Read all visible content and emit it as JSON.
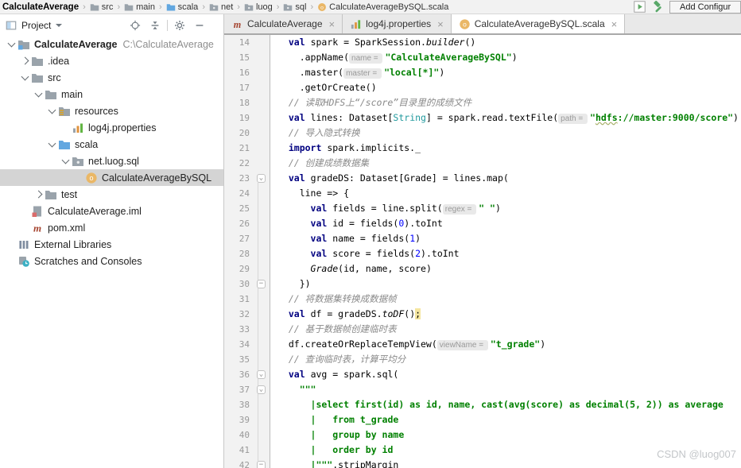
{
  "topbar": {
    "separator": "›",
    "breadcrumbs": [
      {
        "label": "CalculateAverage",
        "icon": null,
        "bold": true
      },
      {
        "label": "src",
        "icon": "folder"
      },
      {
        "label": "main",
        "icon": "folder"
      },
      {
        "label": "scala",
        "icon": "folder-blue"
      },
      {
        "label": "net",
        "icon": "package"
      },
      {
        "label": "luog",
        "icon": "package"
      },
      {
        "label": "sql",
        "icon": "package"
      },
      {
        "label": "CalculateAverageBySQL.scala",
        "icon": "scala-object"
      }
    ],
    "add_config_label": "Add Configur"
  },
  "project_panel": {
    "title": "Project",
    "header_icons": [
      "locate",
      "collapse-all",
      "|",
      "settings",
      "hide"
    ],
    "tree": [
      {
        "indent": 0,
        "arrow": "down",
        "icon": "project-root",
        "label": "CalculateAverage",
        "sub": "C:\\CalculateAverage",
        "bold": true
      },
      {
        "indent": 1,
        "arrow": "right",
        "icon": "folder",
        "label": ".idea"
      },
      {
        "indent": 1,
        "arrow": "down",
        "icon": "folder",
        "label": "src"
      },
      {
        "indent": 2,
        "arrow": "down",
        "icon": "folder",
        "label": "main"
      },
      {
        "indent": 3,
        "arrow": "down",
        "icon": "folder-res",
        "label": "resources"
      },
      {
        "indent": 4,
        "arrow": null,
        "icon": "props",
        "label": "log4j.properties"
      },
      {
        "indent": 3,
        "arrow": "down",
        "icon": "folder-blue",
        "label": "scala"
      },
      {
        "indent": 4,
        "arrow": "down",
        "icon": "package",
        "label": "net.luog.sql"
      },
      {
        "indent": 5,
        "arrow": null,
        "icon": "scala-object",
        "label": "CalculateAverageBySQL",
        "selected": true
      },
      {
        "indent": 2,
        "arrow": "right",
        "icon": "folder",
        "label": "test"
      },
      {
        "indent": 1,
        "arrow": null,
        "icon": "iml",
        "label": "CalculateAverage.iml"
      },
      {
        "indent": 1,
        "arrow": null,
        "icon": "maven",
        "label": "pom.xml"
      },
      {
        "indent": 0,
        "arrow": null,
        "icon": "libs",
        "label": "External Libraries"
      },
      {
        "indent": 0,
        "arrow": null,
        "icon": "scratches",
        "label": "Scratches and Consoles"
      }
    ]
  },
  "tabs": [
    {
      "label": "CalculateAverage",
      "icon": "maven",
      "active": false,
      "close": "×"
    },
    {
      "label": "log4j.properties",
      "icon": "props",
      "active": false,
      "close": "×"
    },
    {
      "label": "CalculateAverageBySQL.scala",
      "icon": "scala-object",
      "active": true,
      "close": "×"
    }
  ],
  "editor": {
    "lines": [
      {
        "n": 14,
        "fold": null,
        "tokens": [
          [
            "p",
            "  "
          ],
          [
            "k",
            "val"
          ],
          [
            "p",
            " spark = SparkSession."
          ],
          [
            "i",
            "builder"
          ],
          [
            "p",
            "()"
          ]
        ]
      },
      {
        "n": 15,
        "fold": null,
        "tokens": [
          [
            "p",
            "    .appName("
          ],
          [
            "h",
            "name = "
          ],
          [
            "s",
            "\"CalculateAverageBySQL\""
          ],
          [
            "p",
            ")"
          ]
        ]
      },
      {
        "n": 16,
        "fold": null,
        "tokens": [
          [
            "p",
            "    .master("
          ],
          [
            "h",
            "master = "
          ],
          [
            "s",
            "\"local[*]\""
          ],
          [
            "p",
            ")"
          ]
        ]
      },
      {
        "n": 17,
        "fold": null,
        "tokens": [
          [
            "p",
            "    .getOrCreate()"
          ]
        ]
      },
      {
        "n": 18,
        "fold": null,
        "tokens": [
          [
            "c",
            "  // 读取HDFS上“/score”目录里的成绩文件"
          ]
        ]
      },
      {
        "n": 19,
        "fold": null,
        "tokens": [
          [
            "p",
            "  "
          ],
          [
            "k",
            "val"
          ],
          [
            "p",
            " lines: Dataset["
          ],
          [
            "t",
            "String"
          ],
          [
            "p",
            "] = spark.read.textFile("
          ],
          [
            "h",
            "path = "
          ],
          [
            "s",
            "\""
          ],
          [
            "su",
            "hdfs"
          ],
          [
            "s",
            "://master:9000/score\""
          ],
          [
            "p",
            ")"
          ]
        ]
      },
      {
        "n": 20,
        "fold": null,
        "tokens": [
          [
            "c",
            "  // 导入隐式转换"
          ]
        ]
      },
      {
        "n": 21,
        "fold": null,
        "tokens": [
          [
            "p",
            "  "
          ],
          [
            "k",
            "import"
          ],
          [
            "p",
            " spark.implicits._"
          ]
        ]
      },
      {
        "n": 22,
        "fold": null,
        "tokens": [
          [
            "c",
            "  // 创建成绩数据集"
          ]
        ]
      },
      {
        "n": 23,
        "fold": "start",
        "tokens": [
          [
            "p",
            "  "
          ],
          [
            "k",
            "val"
          ],
          [
            "p",
            " gradeDS: Dataset[Grade] = lines.map("
          ]
        ]
      },
      {
        "n": 24,
        "fold": null,
        "tokens": [
          [
            "p",
            "    line => {"
          ]
        ]
      },
      {
        "n": 25,
        "fold": null,
        "tokens": [
          [
            "p",
            "      "
          ],
          [
            "k",
            "val"
          ],
          [
            "p",
            " fields = line.split("
          ],
          [
            "h",
            "regex = "
          ],
          [
            "s",
            "\" \""
          ],
          [
            "p",
            ")"
          ]
        ]
      },
      {
        "n": 26,
        "fold": null,
        "tokens": [
          [
            "p",
            "      "
          ],
          [
            "k",
            "val"
          ],
          [
            "p",
            " id = fields("
          ],
          [
            "n2",
            "0"
          ],
          [
            "p",
            ").toInt"
          ]
        ]
      },
      {
        "n": 27,
        "fold": null,
        "tokens": [
          [
            "p",
            "      "
          ],
          [
            "k",
            "val"
          ],
          [
            "p",
            " name = fields("
          ],
          [
            "n2",
            "1"
          ],
          [
            "p",
            ")"
          ]
        ]
      },
      {
        "n": 28,
        "fold": null,
        "tokens": [
          [
            "p",
            "      "
          ],
          [
            "k",
            "val"
          ],
          [
            "p",
            " score = fields("
          ],
          [
            "n2",
            "2"
          ],
          [
            "p",
            ").toInt"
          ]
        ]
      },
      {
        "n": 29,
        "fold": null,
        "tokens": [
          [
            "p",
            "      "
          ],
          [
            "i",
            "Grade"
          ],
          [
            "p",
            "(id, name, score)"
          ]
        ]
      },
      {
        "n": 30,
        "fold": "end",
        "tokens": [
          [
            "p",
            "    })"
          ]
        ]
      },
      {
        "n": 31,
        "fold": null,
        "tokens": [
          [
            "c",
            "  // 将数据集转换成数据帧"
          ]
        ]
      },
      {
        "n": 32,
        "fold": null,
        "tokens": [
          [
            "p",
            "  "
          ],
          [
            "k",
            "val"
          ],
          [
            "p",
            " df = gradeDS."
          ],
          [
            "i",
            "toDF"
          ],
          [
            "p",
            "()"
          ],
          [
            "w",
            ";"
          ]
        ]
      },
      {
        "n": 33,
        "fold": null,
        "tokens": [
          [
            "c",
            "  // 基于数据帧创建临时表"
          ]
        ]
      },
      {
        "n": 34,
        "fold": null,
        "tokens": [
          [
            "p",
            "  df.createOrReplaceTempView("
          ],
          [
            "h",
            "viewName = "
          ],
          [
            "s",
            "\"t_grade\""
          ],
          [
            "p",
            ")"
          ]
        ]
      },
      {
        "n": 35,
        "fold": null,
        "tokens": [
          [
            "c",
            "  // 查询临时表，计算平均分"
          ]
        ]
      },
      {
        "n": 36,
        "fold": "start",
        "tokens": [
          [
            "p",
            "  "
          ],
          [
            "k",
            "val"
          ],
          [
            "p",
            " avg = spark.sql("
          ]
        ]
      },
      {
        "n": 37,
        "fold": "start",
        "tokens": [
          [
            "s",
            "    \"\"\""
          ]
        ]
      },
      {
        "n": 38,
        "fold": null,
        "tokens": [
          [
            "s",
            "      |select first(id) as id, name, cast(avg(score) as decimal(5, 2)) as average"
          ]
        ]
      },
      {
        "n": 39,
        "fold": null,
        "tokens": [
          [
            "s",
            "      |   from t_grade"
          ]
        ]
      },
      {
        "n": 40,
        "fold": null,
        "tokens": [
          [
            "s",
            "      |   group by name"
          ]
        ]
      },
      {
        "n": 41,
        "fold": null,
        "tokens": [
          [
            "s",
            "      |   order by id"
          ]
        ]
      },
      {
        "n": 42,
        "fold": "end",
        "tokens": [
          [
            "s",
            "      |\"\"\""
          ],
          [
            "p",
            ".stripMargin"
          ]
        ]
      }
    ]
  },
  "watermark": "CSDN @luog007",
  "colors": {
    "keyword": "#000080",
    "string": "#008000",
    "comment": "#8a8a8a",
    "type": "#20999d",
    "selection_bg": "#d4d4d4",
    "folder_gray": "#9aa3ab",
    "folder_blue": "#62a7e0",
    "scala_object": "#eab766",
    "run_green": "#5fa865",
    "warn_highlight": "#f5e6a0"
  }
}
